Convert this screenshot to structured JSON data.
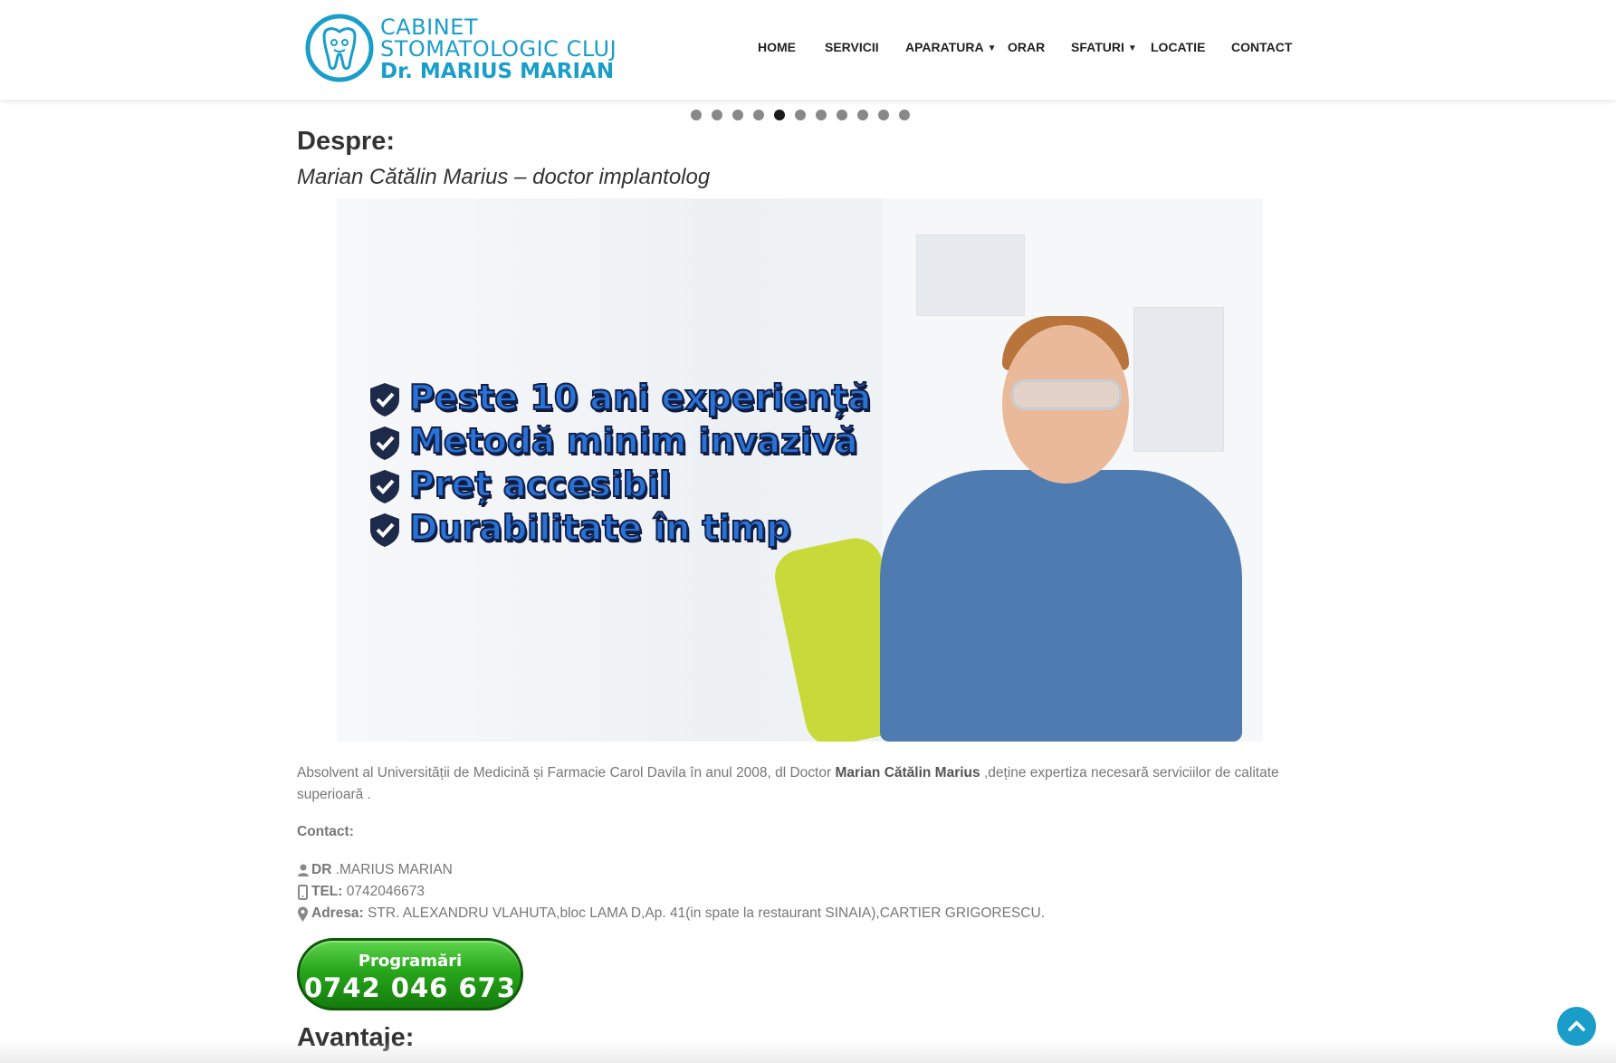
{
  "logo": {
    "line1": "CABINET",
    "line2": "STOMATOLOGIC CLUJ",
    "line3": "Dr. MARIUS MARIAN",
    "color": "#1a9ec9"
  },
  "nav": {
    "items": [
      {
        "label": "HOME",
        "dropdown": false
      },
      {
        "label": "SERVICII",
        "dropdown": false
      },
      {
        "label": "APARATURA",
        "dropdown": true
      },
      {
        "label": "ORAR",
        "dropdown": false
      },
      {
        "label": "SFATURI",
        "dropdown": true
      },
      {
        "label": "LOCATIE",
        "dropdown": false
      },
      {
        "label": "CONTACT",
        "dropdown": false
      }
    ]
  },
  "slider": {
    "dot_count": 11,
    "active_index": 4
  },
  "about": {
    "heading": "Despre:",
    "subtitle": "Marian Cătălin Marius – doctor implantolog",
    "hero_checks": [
      "Peste 10 ani experiență",
      "Metodă minim invazivă",
      "Preț accesibil",
      "Durabilitate în timp"
    ],
    "para_before": "Absolvent al Universității de Medicină și Farmacie Carol Davila în anul 2008, dl Doctor ",
    "para_name": "Marian Cătălin Marius",
    "para_after": " ,deține expertiza necesară serviciilor de calitate superioară ."
  },
  "contact": {
    "heading": "Contact:",
    "doctor_label": "DR",
    "doctor_value": " .MARIUS MARIAN",
    "tel_label": "TEL:",
    "tel_value": " 0742046673",
    "address_label": "Adresa:",
    "address_value": " STR. ALEXANDRU VLAHUTA,bloc LAMA D,Ap. 41(in spate la restaurant SINAIA),CARTIER GRIGORESCU."
  },
  "cta": {
    "label": "Programări",
    "phone": "0742 046 673",
    "color": "#27a61b"
  },
  "advantages": {
    "heading": "Avantaje:"
  },
  "icons": {
    "doctor": "user-icon",
    "tel": "mobile-phone-icon",
    "address": "map-marker-icon",
    "back_to_top": "chevron-up-icon"
  }
}
